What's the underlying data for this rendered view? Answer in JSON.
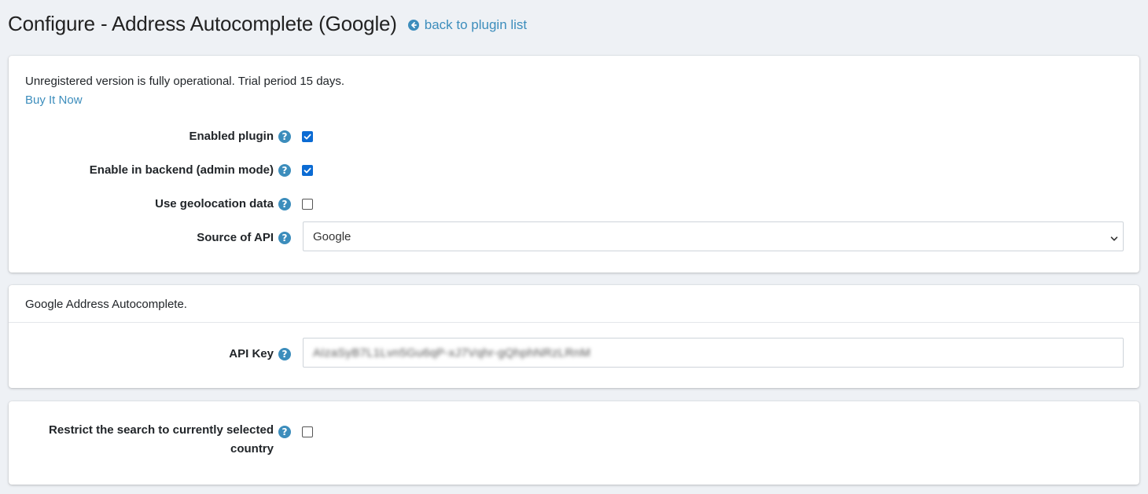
{
  "header": {
    "title": "Configure - Address Autocomplete (Google)",
    "back_link": "back to plugin list"
  },
  "general": {
    "notice": "Unregistered version is fully operational. Trial period 15 days.",
    "buy_link": "Buy It Now",
    "fields": {
      "enabled_plugin": {
        "label": "Enabled plugin",
        "checked": true
      },
      "enable_backend": {
        "label": "Enable in backend (admin mode)",
        "checked": true
      },
      "use_geolocation": {
        "label": "Use geolocation data",
        "checked": false
      },
      "source_of_api": {
        "label": "Source of API",
        "value": "Google"
      }
    }
  },
  "google": {
    "header": "Google Address Autocomplete.",
    "api_key": {
      "label": "API Key",
      "value": "AIzaSyB7L1Lvn5Gu6qP-xJ7Vqhr-gQhphNRzLRnM"
    }
  },
  "restrict": {
    "label_line1": "Restrict the search to currently selected",
    "label_line2": "country",
    "checked": false
  },
  "colors": {
    "accent": "#3c8dbc",
    "checkbox_checked": "#0b6bd3",
    "background": "#eef1f5"
  },
  "icons": {
    "help": "question-circle-icon",
    "back": "arrow-circle-left-icon",
    "select": "chevron-down-icon"
  }
}
